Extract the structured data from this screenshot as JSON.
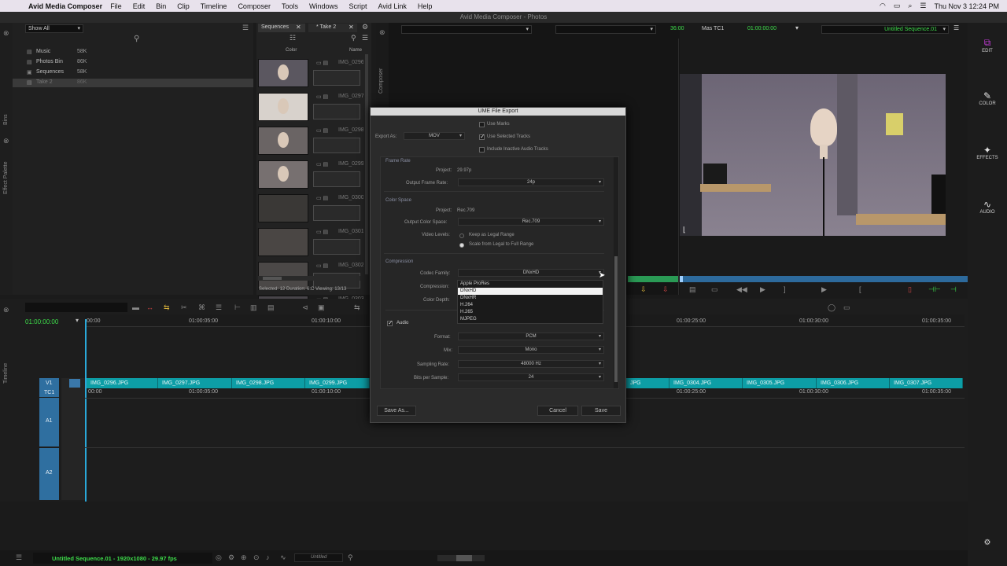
{
  "menubar": {
    "app_name": "Avid Media Composer",
    "items": [
      "File",
      "Edit",
      "Bin",
      "Clip",
      "Timeline",
      "Composer",
      "Tools",
      "Windows",
      "Script",
      "Avid Link",
      "Help"
    ],
    "clock": "Thu Nov 3  12:24 PM"
  },
  "window_title": "Avid Media Composer - Photos",
  "bin_list": {
    "filter": "Show All",
    "items": [
      {
        "name": "Music",
        "size": "58K"
      },
      {
        "name": "Photos Bin",
        "size": "86K"
      },
      {
        "name": "Sequences",
        "size": "58K"
      },
      {
        "name": "Take 2",
        "size": "86K"
      }
    ],
    "side_tabs": [
      "Bins",
      "Effect Palette"
    ]
  },
  "bin": {
    "tabs": [
      "Sequences",
      "* Take 2"
    ],
    "col_color": "Color",
    "col_name": "Name",
    "clip_names": [
      "IMG_0296",
      "IMG_0297",
      "IMG_0298",
      "IMG_0299",
      "IMG_0300",
      "IMG_0301",
      "IMG_0302",
      "IMG_0303",
      "IMG_0304"
    ],
    "status": "Selected: 12 Duration: 6:C  Viewing: 13/13"
  },
  "composer": {
    "side_label": "Composer",
    "tc_a": "36:00",
    "tc_label": "Mas  TC1",
    "tc_b": "01:00:00:00",
    "sequence_name": "Untitled Sequence.01"
  },
  "right_toolbar": [
    "EDIT",
    "COLOR",
    "EFFECTS",
    "AUDIO"
  ],
  "timeline": {
    "side_label": "Timeline",
    "timecode": "01:00:00:00",
    "ruler": [
      "00:00",
      "01:00:05:00",
      "01:00:10:00",
      "01:00:25:00",
      "01:00:30:00",
      "01:00:35:00"
    ],
    "tc_row": [
      "00:00",
      "01:00:05:00",
      "01:00:10:00",
      "01:00:25:00",
      "01:00:30:00",
      "01:00:35:00"
    ],
    "tracks": [
      "V1",
      "TC1",
      "A1",
      "A2"
    ],
    "clips_left": [
      "IMG_0296.JPG",
      "IMG_0297.JPG",
      "IMG_0298.JPG",
      "IMG_0299.JPG"
    ],
    "clips_right": [
      "JPG",
      "IMG_0304.JPG",
      "IMG_0305.JPG",
      "IMG_0306.JPG",
      "IMG_0307.JPG"
    ],
    "status": "Untitled Sequence.01 - 1920x1080 - 29.97 fps",
    "zoom_label": "Untitled"
  },
  "dialog": {
    "title": "UME File Export",
    "export_as_label": "Export As:",
    "export_as_value": "MOV",
    "use_marks": "Use Marks",
    "use_selected_tracks": "Use Selected Tracks",
    "include_inactive": "Include Inactive Audio Tracks",
    "frame_rate_section": "Frame Rate",
    "project_label": "Project:",
    "project_fps": "29.97p",
    "output_frame_rate_label": "Output Frame Rate:",
    "output_frame_rate": "24p",
    "color_space_section": "Color Space",
    "project_color": "Rec.709",
    "output_color_space_label": "Output Color Space:",
    "output_color_space": "Rec.709",
    "video_levels_label": "Video Levels:",
    "keep_legal": "Keep as Legal Range",
    "scale_legal": "Scale from Legal to Full Range",
    "compression_section": "Compression",
    "codec_family_label": "Codec Family:",
    "codec_family": "DNxHD",
    "compression_label": "Compression:",
    "color_depth_label": "Color Depth:",
    "codec_options": [
      "Apple ProRes",
      "DNxHD",
      "DNxHR",
      "H.264",
      "H.265",
      "MJPEG"
    ],
    "codec_selected_index": 1,
    "audio_label": "Audio",
    "format_label": "Format:",
    "format": "PCM",
    "mix_label": "Mix:",
    "mix": "Mono",
    "sampling_rate_label": "Sampling Rate:",
    "sampling_rate": "48000 Hz",
    "bits_label": "Bits per Sample:",
    "bits": "24",
    "save_as": "Save As...",
    "cancel": "Cancel",
    "save": "Save"
  },
  "colors": {
    "accent_green": "#3ddc4a",
    "clip_teal": "#0d9ea6",
    "track_blue": "#2f6fa0",
    "menu_bg": "#e8e2ec"
  }
}
